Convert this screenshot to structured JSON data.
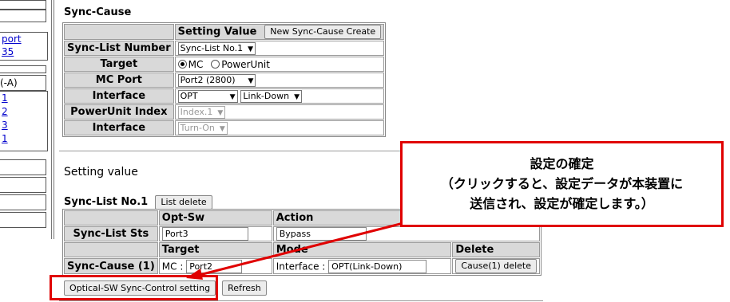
{
  "nav": {
    "link1": "port",
    "link2": "35",
    "text1": "(-A)",
    "link3": "1",
    "link4": "2",
    "link5": "3",
    "link6": "1"
  },
  "sync_cause": {
    "title": "Sync-Cause",
    "setting_value_header": "Setting Value",
    "new_button": "New Sync-Cause Create",
    "rows": {
      "sync_list_number": {
        "label": "Sync-List Number",
        "value": "Sync-List No.1"
      },
      "target": {
        "label": "Target",
        "option_mc": "MC",
        "option_powerunit": "PowerUnit",
        "selected": "MC"
      },
      "mc_port": {
        "label": "MC Port",
        "value": "Port2 (2800)"
      },
      "interface": {
        "label": "Interface",
        "value1": "OPT",
        "value2": "Link-Down"
      },
      "powerunit_index": {
        "label": "PowerUnit Index",
        "value": "Index.1"
      },
      "interface2": {
        "label": "Interface",
        "value": "Turn-On"
      }
    }
  },
  "setting_value": {
    "title": "Setting value",
    "list_label": "Sync-List No.1",
    "list_delete_button": "List delete",
    "headers": {
      "opt_sw": "Opt-Sw",
      "action": "Action",
      "target": "Target",
      "mode": "Mode",
      "delete": "Delete"
    },
    "sts_row": {
      "label": "Sync-List Sts",
      "port_value": "Port3",
      "action_value": "Bypass"
    },
    "cause_row": {
      "label": "Sync-Cause (1)",
      "target_prefix": "MC :",
      "target_value": "Port2",
      "mode_prefix": "Interface :",
      "mode_value": "OPT(Link-Down)",
      "delete_button": "Cause(1) delete"
    },
    "control_button": "Optical-SW Sync-Control setting",
    "refresh_button": "Refresh"
  },
  "callout": {
    "line1": "設定の確定",
    "line2": "（クリックすると、設定データが本装置に",
    "line3": "送信され、設定が確定します。）"
  },
  "colors": {
    "accent_red": "#e00000",
    "header_gray": "#d9d9d9",
    "link_blue": "#0000cc"
  },
  "icons": {
    "dropdown": "chevron-down-icon",
    "radio": "radio-icon"
  }
}
